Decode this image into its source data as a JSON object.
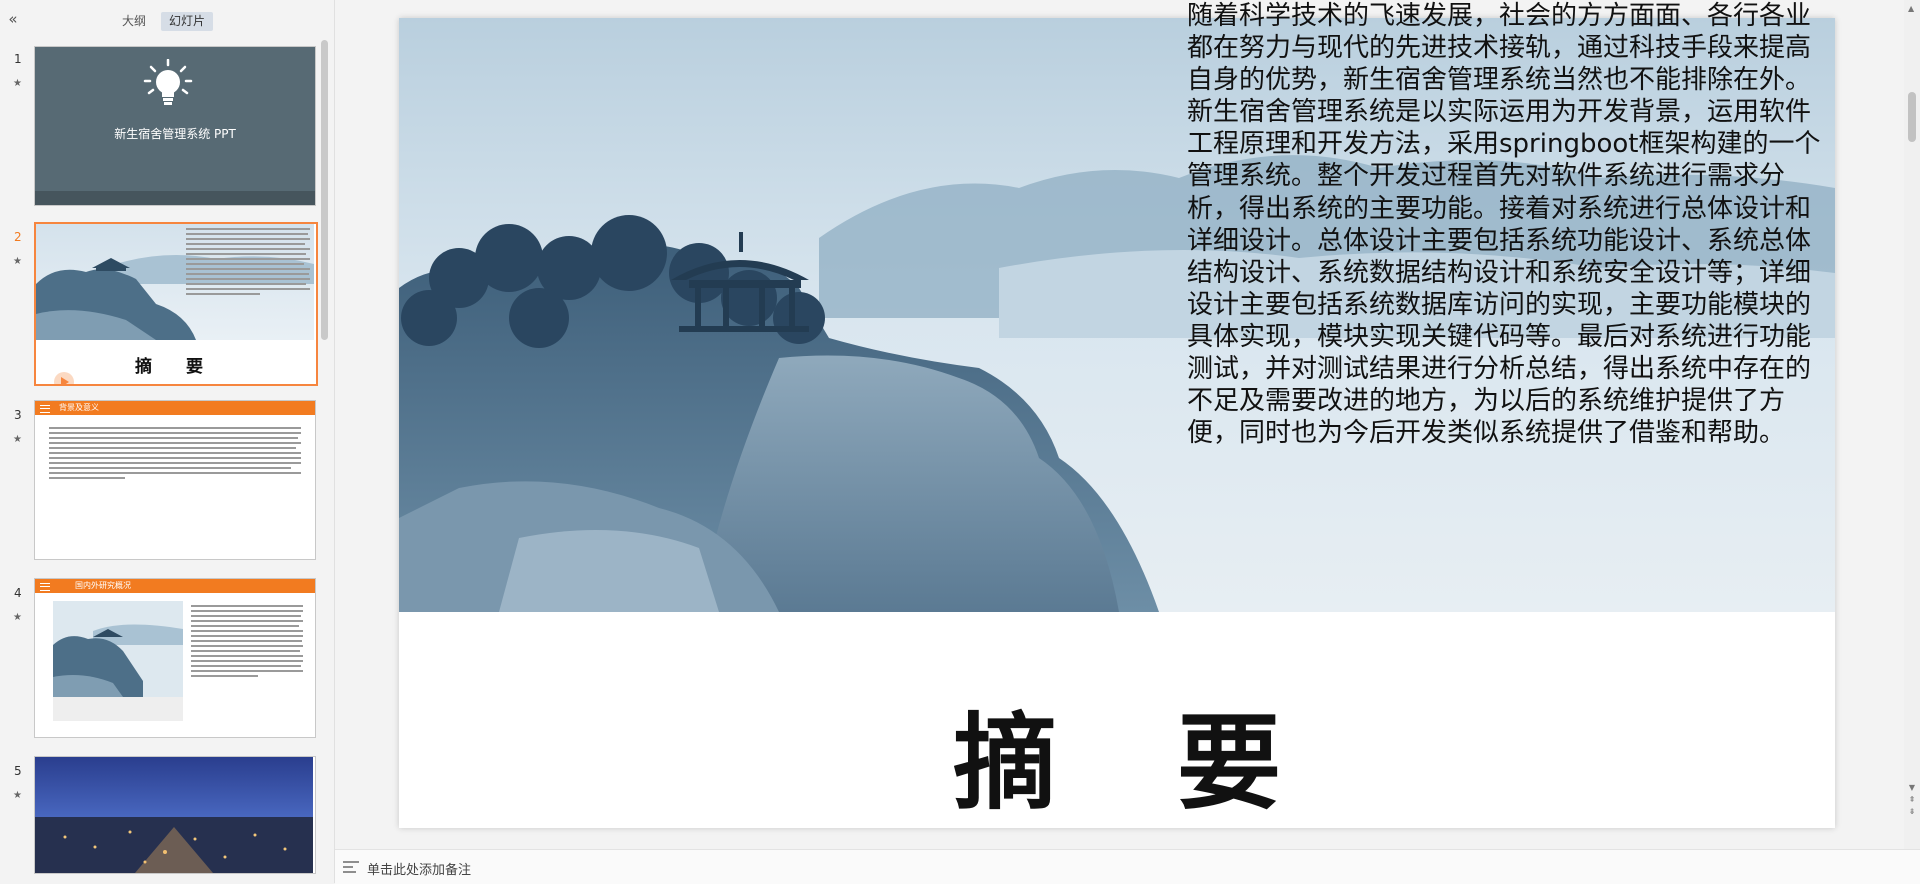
{
  "left_panel": {
    "tabs": [
      {
        "label": "大纲",
        "active": false
      },
      {
        "label": "幻灯片",
        "active": true
      }
    ],
    "collapse_icon": "double-chevron-left-icon",
    "slides": [
      {
        "number": "1",
        "star": "★",
        "title": "新生宿舍管理系统  PPT"
      },
      {
        "number": "2",
        "star": "★",
        "title": "摘    要",
        "selected": true
      },
      {
        "number": "3",
        "star": "★",
        "header": "背景及意义"
      },
      {
        "number": "4",
        "star": "★",
        "header": "国内外研究概况"
      },
      {
        "number": "5",
        "star": "★"
      }
    ]
  },
  "slide": {
    "body_text": "随着科学技术的飞速发展，社会的方方面面、各行各业都在努力与现代的先进技术接轨，通过科技手段来提高自身的优势，新生宿舍管理系统当然也不能排除在外。新生宿舍管理系统是以实际运用为开发背景，运用软件工程原理和开发方法，采用springboot框架构建的一个管理系统。整个开发过程首先对软件系统进行需求分析，得出系统的主要功能。接着对系统进行总体设计和详细设计。总体设计主要包括系统功能设计、系统总体结构设计、系统数据结构设计和系统安全设计等；详细设计主要包括系统数据库访问的实现，主要功能模块的具体实现，模块实现关键代码等。最后对系统进行功能测试，并对测试结果进行分析总结，得出系统中存在的不足及需要改进的地方，为以后的系统维护提供了方便，同时也为今后开发类似系统提供了借鉴和帮助。",
    "title": "摘要"
  },
  "notes": {
    "placeholder": "单击此处添加备注"
  }
}
